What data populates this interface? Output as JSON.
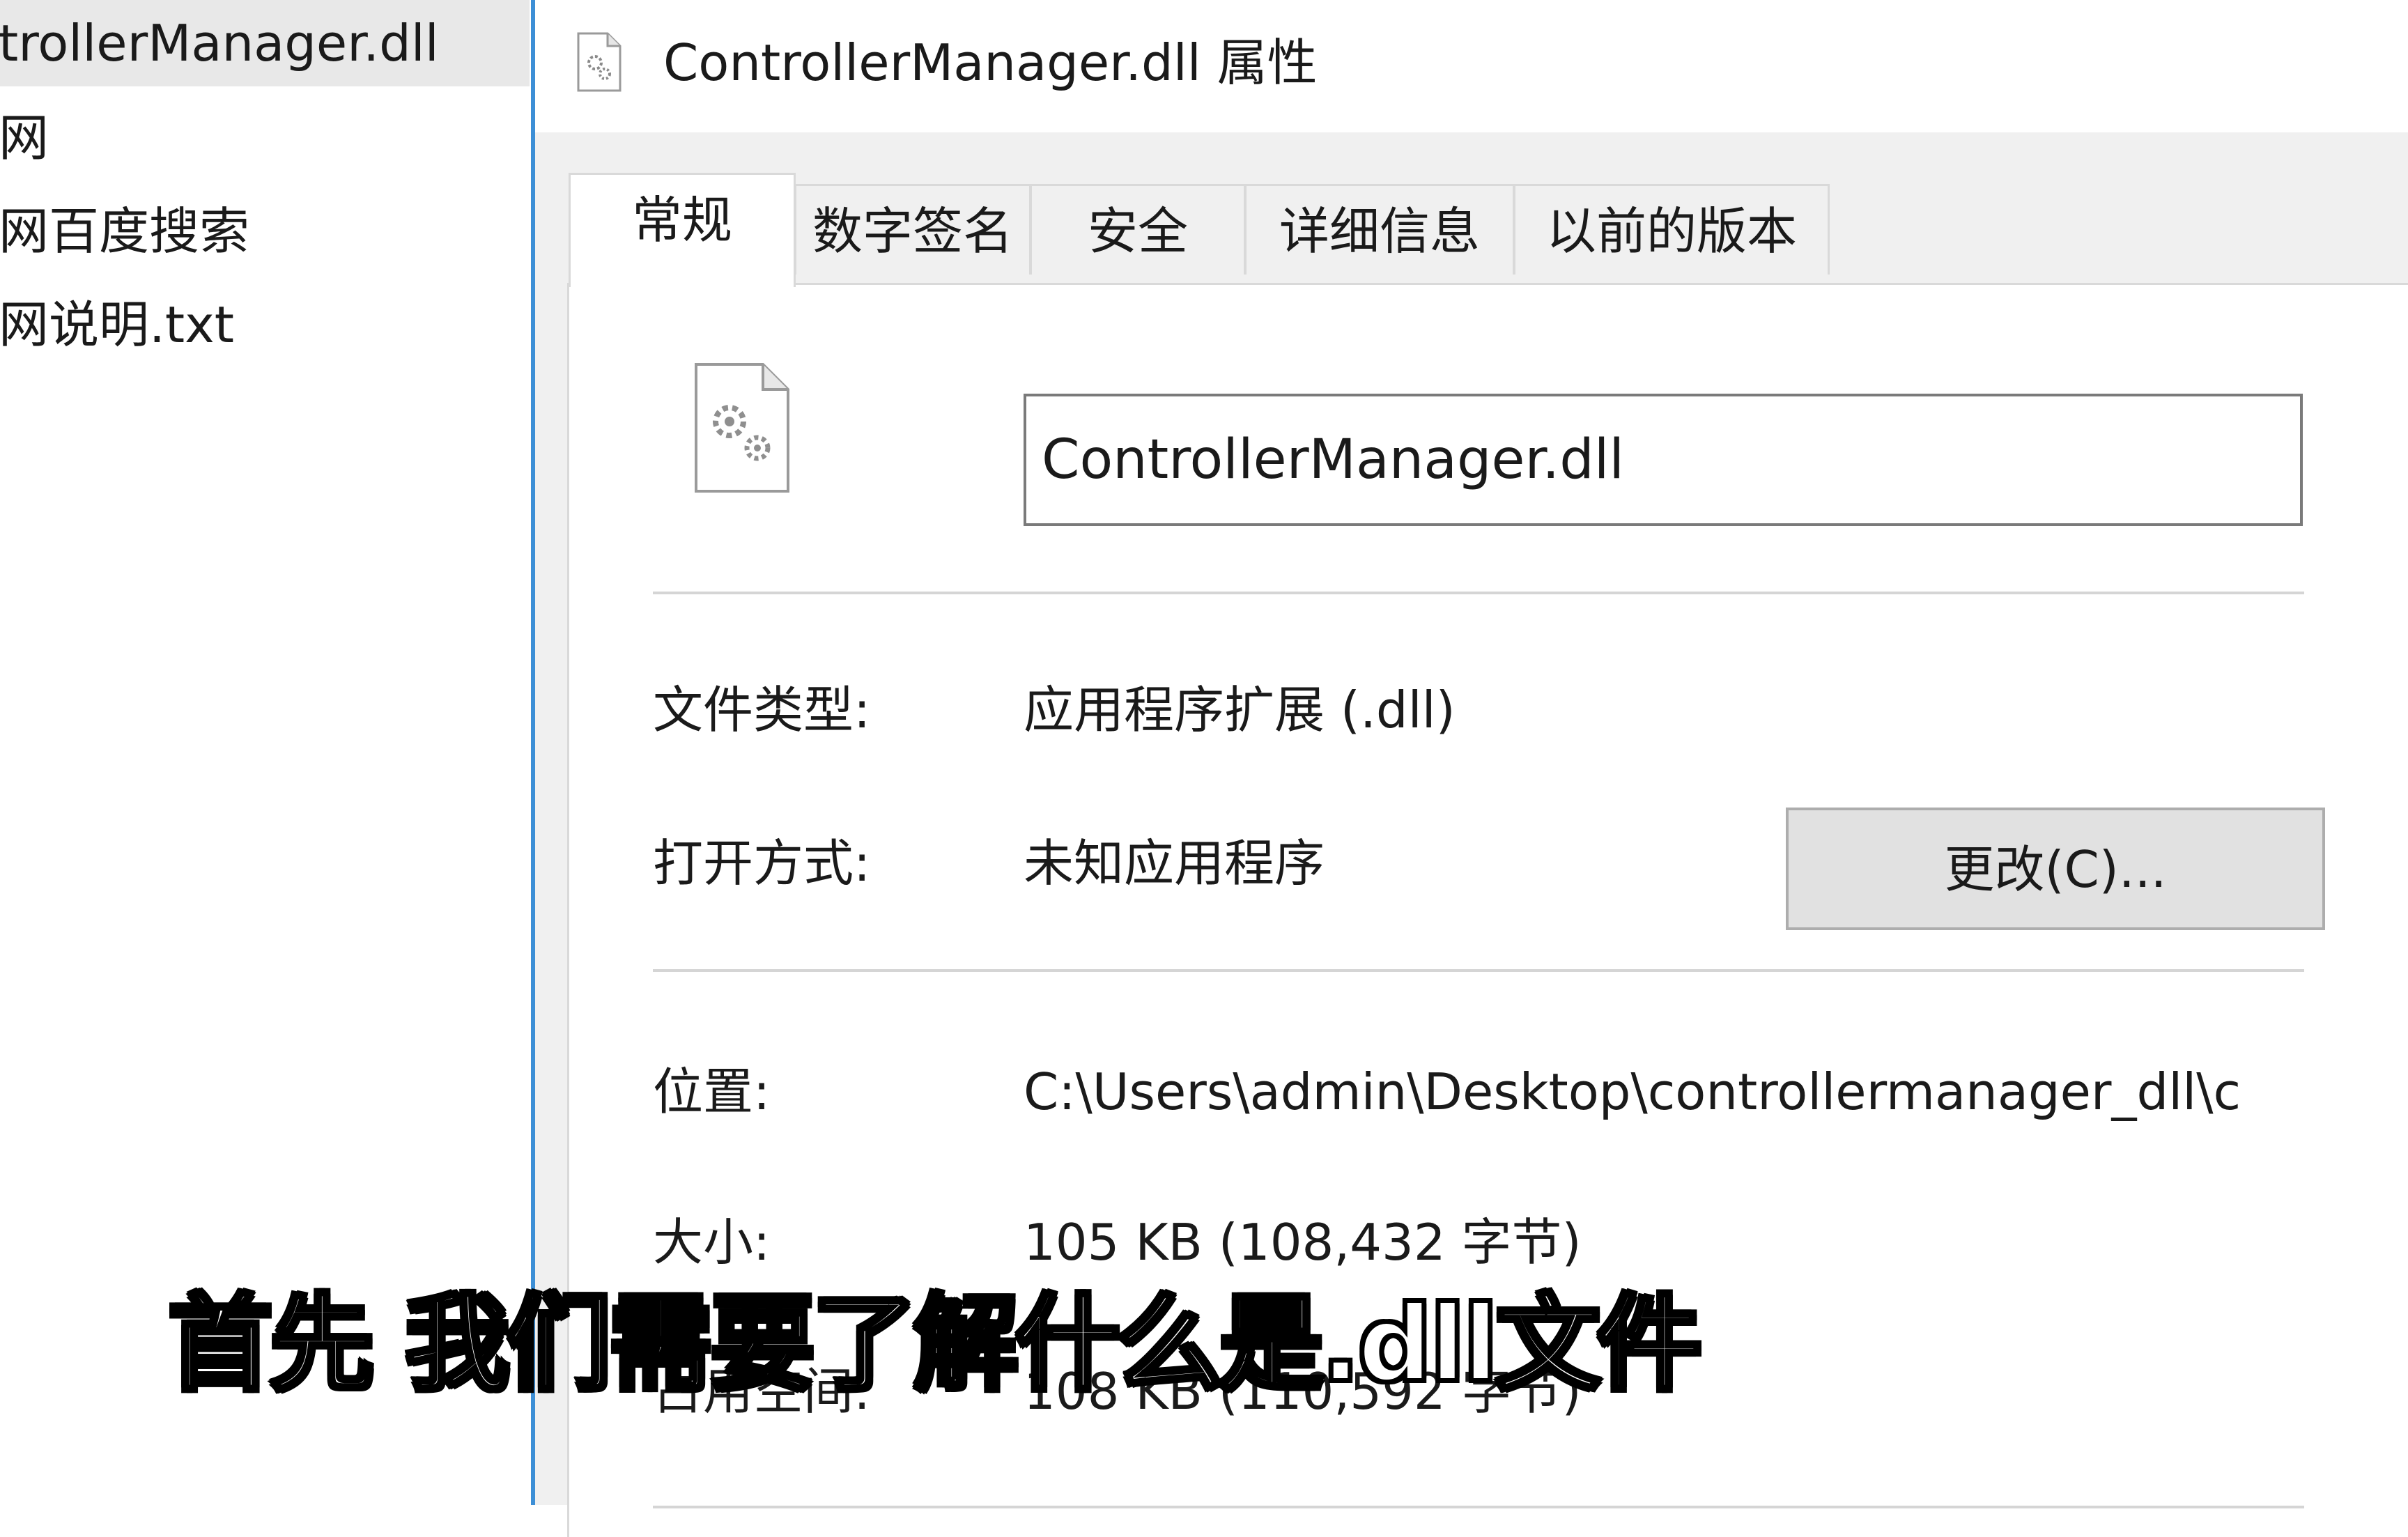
{
  "explorer": {
    "items": [
      {
        "label": "trollerManager.dll",
        "selected": true
      },
      {
        "label": "网",
        "selected": false
      },
      {
        "label": "网百度搜索",
        "selected": false
      },
      {
        "label": "网说明.txt",
        "selected": false
      }
    ]
  },
  "dialog": {
    "title": "ControllerManager.dll 属性",
    "tabs": [
      {
        "label": "常规",
        "active": true
      },
      {
        "label": "数字签名",
        "active": false
      },
      {
        "label": "安全",
        "active": false
      },
      {
        "label": "详细信息",
        "active": false
      },
      {
        "label": "以前的版本",
        "active": false
      }
    ],
    "file_name": "ControllerManager.dll",
    "properties": {
      "type_label": "文件类型:",
      "type_value": "应用程序扩展 (.dll)",
      "open_with_label": "打开方式:",
      "open_with_value": "未知应用程序",
      "change_button": "更改(C)...",
      "location_label": "位置:",
      "location_value": "C:\\Users\\admin\\Desktop\\controllermanager_dll\\c",
      "size_label": "大小:",
      "size_value": "105 KB (108,432 字节)",
      "disk_size_label": "占用空间:",
      "disk_size_value": "108 KB (110,592 字节)"
    }
  },
  "subtitle": "首先 我们需要了解什么是.dll文件",
  "colors": {
    "selection_accent": "#3d8fd6",
    "dialog_background": "#f0f0f0",
    "button_background": "#e1e1e1"
  }
}
